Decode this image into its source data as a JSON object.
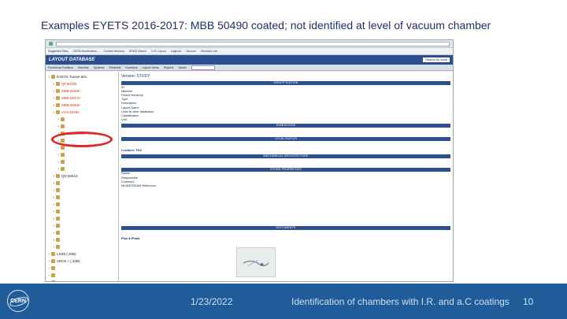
{
  "slide": {
    "title": "Examples EYETS 2016-2017: MBB 50490 coated; not identified at level of vacuum chamber"
  },
  "browser": {
    "bookmarks": [
      "Suggested Sites",
      "CERN Accelerators...",
      "Contact directory",
      "EDMS Search",
      "LHC Layout",
      "Logbook",
      "Vacuum",
      "Windows Live"
    ]
  },
  "app": {
    "name": "LAYOUT DATABASE",
    "search_label": "Search by code",
    "menu": [
      "Functional Positions",
      "Machine",
      "Systems",
      "Electrical",
      "Contracts",
      "Layout Views",
      "Reports",
      "Admin"
    ]
  },
  "tree": {
    "nodes": [
      {
        "label": "EYETS Tunnel 501",
        "level": 0,
        "color": "black"
      },
      {
        "label": "QF.50490",
        "level": 1,
        "color": "red"
      },
      {
        "label": "MBB.50450",
        "level": 1,
        "color": "red"
      },
      {
        "label": "MBB.50470",
        "level": 1,
        "color": "red"
      },
      {
        "label": "MBB.50490",
        "level": 1,
        "color": "red"
      },
      {
        "label": "VVS.50490",
        "level": 1,
        "color": "red"
      },
      {
        "label": "",
        "level": 2,
        "color": "black"
      },
      {
        "label": "",
        "level": 2,
        "color": "black"
      },
      {
        "label": "MBB.50490",
        "level": 2,
        "color": "green"
      },
      {
        "label": "",
        "level": 2,
        "color": "black"
      },
      {
        "label": "",
        "level": 2,
        "color": "black"
      },
      {
        "label": "",
        "level": 2,
        "color": "black"
      },
      {
        "label": "",
        "level": 2,
        "color": "black"
      },
      {
        "label": "",
        "level": 2,
        "color": "black"
      },
      {
        "label": "QD.50510",
        "level": 1,
        "color": "black"
      },
      {
        "label": "",
        "level": 1,
        "color": "black"
      },
      {
        "label": "",
        "level": 1,
        "color": "black"
      },
      {
        "label": "",
        "level": 1,
        "color": "black"
      },
      {
        "label": "",
        "level": 1,
        "color": "black"
      },
      {
        "label": "",
        "level": 1,
        "color": "black"
      },
      {
        "label": "",
        "level": 1,
        "color": "black"
      },
      {
        "label": "",
        "level": 1,
        "color": "black"
      },
      {
        "label": "",
        "level": 1,
        "color": "black"
      },
      {
        "label": "",
        "level": 1,
        "color": "black"
      },
      {
        "label": "",
        "level": 1,
        "color": "black"
      },
      {
        "label": "LSS5 (.20B)",
        "level": 0,
        "color": "black"
      },
      {
        "label": "ARC5 + (.20B)",
        "level": 0,
        "color": "black"
      },
      {
        "label": "",
        "level": 0,
        "color": "black"
      },
      {
        "label": "",
        "level": 0,
        "color": "black"
      },
      {
        "label": "",
        "level": 0,
        "color": "black"
      }
    ]
  },
  "detail": {
    "version": "Version: STUDY",
    "sections": [
      "IDENTIFICATION",
      "DIMENSIONS",
      "LOCALISATION",
      "MECHANICAL ARCHITECTURE",
      "OTHER PROPERTIES",
      "DOCUMENTS"
    ],
    "identification": [
      {
        "k": "ID",
        "v": ""
      },
      {
        "k": "Machine",
        "v": ""
      },
      {
        "k": "Parent hierarchy",
        "v": ""
      },
      {
        "k": "Type",
        "v": ""
      },
      {
        "k": "Description",
        "v": ""
      },
      {
        "k": "Layout Name",
        "v": ""
      },
      {
        "k": "Links to other databases",
        "v": ""
      },
      {
        "k": "Classification",
        "v": ""
      },
      {
        "k": "Unit",
        "v": ""
      }
    ],
    "location_label": "Location: TI04",
    "other_props": [
      "Status",
      "Responsible",
      "Comment",
      "MAINSTREAM Reference"
    ],
    "bottom_links": [
      "Plan & Photo"
    ]
  },
  "footer": {
    "date": "1/23/2022",
    "subject": "Identification of chambers with I.R. and a.C coatings",
    "page": "10",
    "logo": "CERN"
  }
}
